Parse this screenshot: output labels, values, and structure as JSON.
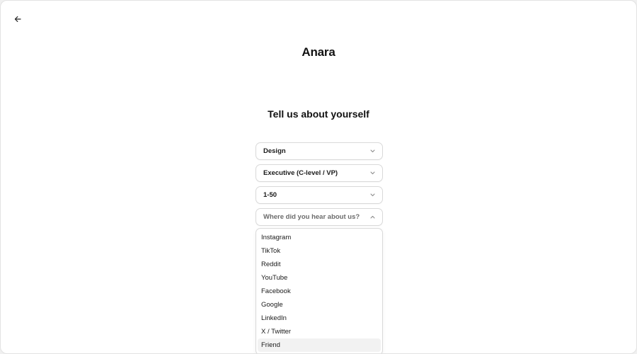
{
  "app": {
    "logo": "Anara"
  },
  "page": {
    "heading": "Tell us about yourself"
  },
  "fields": {
    "role": {
      "value": "Design"
    },
    "level": {
      "value": "Executive (C-level / VP)"
    },
    "company_size": {
      "value": "1-50"
    },
    "referral": {
      "placeholder": "Where did you hear about us?"
    }
  },
  "referral_options": [
    "Instagram",
    "TikTok",
    "Reddit",
    "YouTube",
    "Facebook",
    "Google",
    "LinkedIn",
    "X / Twitter",
    "Friend"
  ],
  "icons": {
    "back": "arrow-left-icon",
    "chevron_down": "chevron-down-icon",
    "chevron_up": "chevron-up-icon"
  },
  "colors": {
    "text": "#111111",
    "border": "#d9d9d9",
    "highlight": "#f2f2f2"
  }
}
